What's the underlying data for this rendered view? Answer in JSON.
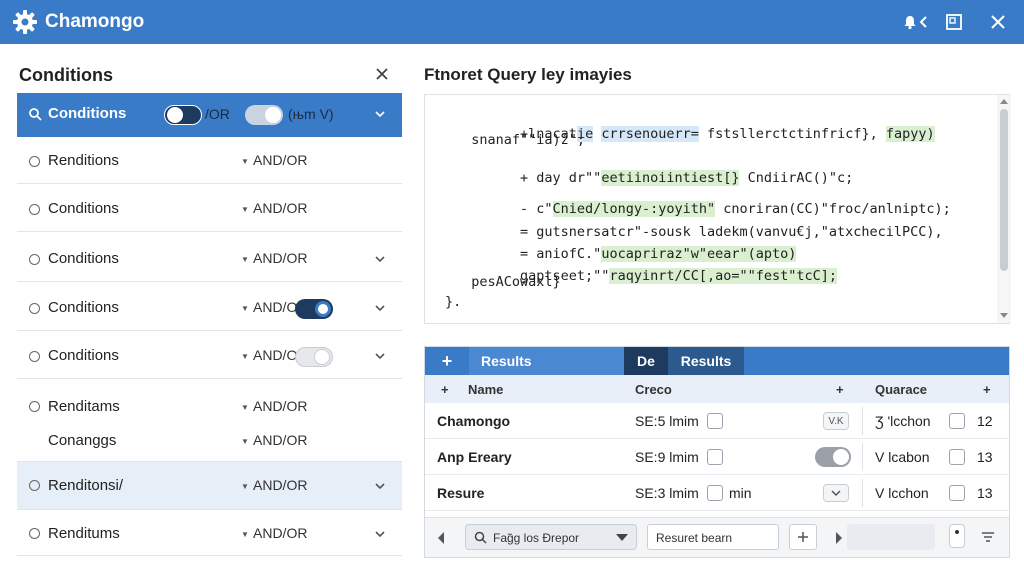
{
  "window": {
    "title": "Chamongo"
  },
  "left_panel": {
    "title": "Conditions",
    "selected_row": {
      "label": "Conditions",
      "toggle1_text": "/OR",
      "toggle2_text": "(њm V)"
    },
    "rows": [
      {
        "label": "Renditions",
        "andor": "AND/OR"
      },
      {
        "label": "Conditions",
        "andor": "AND/OR"
      },
      {
        "label": "Conditions",
        "andor": "AND/OR"
      },
      {
        "label": "Conditions",
        "andor": "AND/OR"
      },
      {
        "label": "Conditions",
        "andor": "AND/OR"
      },
      {
        "label": "Renditams",
        "andor": "AND/OR"
      },
      {
        "label": "Conanggs",
        "andor": "AND/OR"
      },
      {
        "label": "Renditonsi/",
        "andor": "AND/OR"
      },
      {
        "label": "Renditums",
        "andor": "AND/OR"
      }
    ]
  },
  "query": {
    "title": "Ftnoret Query ley imayies",
    "lines": [
      {
        "a": "+lnacat",
        "b": "ie",
        "c": "crrsenouerr=",
        "d": "fstsllerctctinfricf},",
        "e": "fapyy)"
      },
      {
        "a": "  snanaf\"\"ia)ž\";",
        "b": "",
        "c": "",
        "d": "",
        "e": ""
      },
      {
        "a": "+ day dr\"\"",
        "b": "",
        "c": "eetiinoiintiest[}",
        "d": " Cndiir",
        "e": "AC()\"c;"
      },
      {
        "a": "- c\"",
        "b": "",
        "c": "Cnied/longy-:yoyith\"",
        "d": " cnoriran(CC)\"froc/anlniptc);",
        "e": ""
      },
      {
        "a": "= gutsnersatcr\"-",
        "b": "",
        "c": "",
        "d": "sousk ladekm(vanvu€j,\"atxchecil",
        "e": "PCC),"
      },
      {
        "a": "= aniofC.\"",
        "b": "",
        "c": "uocapriraz\"w\"eear\"",
        "d": "",
        "e": "(apto)"
      },
      {
        "a": "gaptseet;\"\"",
        "b": "",
        "c": "raqyinrt/CC[,ao=\"\"fest\"",
        "d": "",
        "e": "tcC];"
      },
      {
        "a": "  pesACowaxl}",
        "b": "",
        "c": "",
        "d": "",
        "e": ""
      },
      {
        "a": "}.",
        "b": "",
        "c": "",
        "d": "",
        "e": ""
      }
    ]
  },
  "results": {
    "tab_plus": "+",
    "tab1": "Results",
    "tab2": "De",
    "tab3": "Results",
    "col_plus": "+",
    "col_name": "Name",
    "col_creco": "Creco",
    "col_plus2": "+",
    "col_quarace": "Quarace",
    "col_plus3": "+",
    "rows": [
      {
        "name": "Chamongo",
        "creco": "SE:5 lmim",
        "extra": "",
        "mini": "V.K",
        "q": "Ʒ 'lcchon",
        "num": "12"
      },
      {
        "name": "Anp Ereary",
        "creco": "SE:9 lmim",
        "extra": "",
        "mini": "",
        "q": "V  lcabon",
        "num": "13"
      },
      {
        "name": "Resure",
        "creco": "SE:3 lmim",
        "extra": "min",
        "mini": "",
        "q": "V  lcchon",
        "num": "13"
      }
    ],
    "footer": {
      "search_value": "Fag̃g los Ɖrepor",
      "field_value": "Resuret bearn"
    }
  }
}
